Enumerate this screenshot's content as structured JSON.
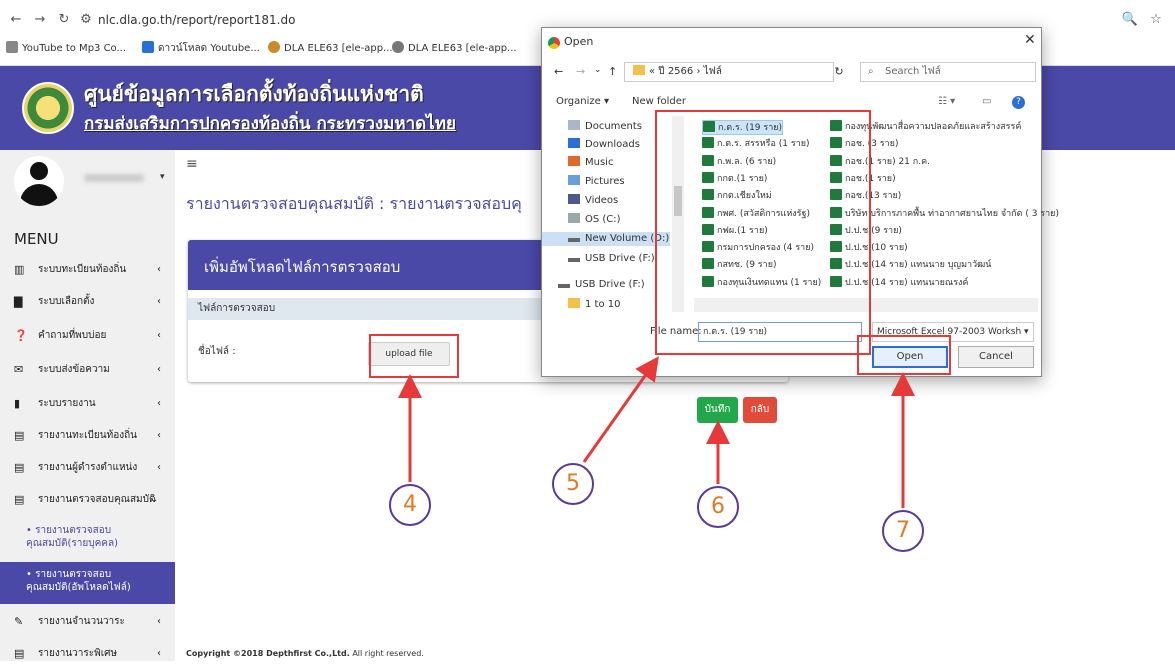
{
  "browser": {
    "url": "nlc.dla.go.th/report/report181.do",
    "bookmarks": [
      "YouTube to Mp3 Co...",
      "ดาวน์โหลด Youtube...",
      "DLA ELE63 [ele-app...",
      "DLA ELE63 [ele-app..."
    ]
  },
  "site": {
    "title": "ศูนย์ข้อมูลการเลือกตั้งท้องถิ่นแห่งชาติ",
    "subtitle": "กรมส่งเสริมการปกครองท้องถิ่น กระทรวงมหาดไทย"
  },
  "sidebar": {
    "menu_title": "MENU",
    "items": [
      {
        "icon": "▥",
        "label": "ระบบทะเบียนท้องถิ่น",
        "chevron": "‹"
      },
      {
        "icon": "▇",
        "label": "ระบบเลือกตั้ง",
        "chevron": "‹"
      },
      {
        "icon": "❓",
        "label": "คำถามที่พบบ่อย",
        "chevron": "‹"
      },
      {
        "icon": "✉",
        "label": "ระบบส่งข้อความ",
        "chevron": "‹"
      },
      {
        "icon": "▮",
        "label": "ระบบรายงาน",
        "chevron": "‹"
      },
      {
        "icon": "▤",
        "label": "รายงานทะเบียนท้องถิ่น",
        "chevron": "‹"
      },
      {
        "icon": "▤",
        "label": "รายงานผู้ดำรงตำแหน่ง",
        "chevron": "‹"
      },
      {
        "icon": "▤",
        "label": "รายงานตรวจสอบคุณสมบัติ",
        "chevron": "⌄"
      }
    ],
    "sub_items": [
      "• รายงานตรวจสอบ คุณสมบัติ(รายบุคคล)",
      "• รายงานตรวจสอบ คุณสมบัติ(อัพโหลดไฟล์)"
    ],
    "bottom_items": [
      {
        "icon": "✎",
        "label": "รายงานจำนวนวาระ",
        "chevron": "‹"
      },
      {
        "icon": "▤",
        "label": "รายงานวาระพิเศษ",
        "chevron": "‹"
      }
    ]
  },
  "main": {
    "page_title": "รายงานตรวจสอบคุณสมบัติ : รายงานตรวจสอบคุ",
    "card_title": "เพิ่มอัพโหลดไฟล์การตรวจสอบ",
    "card_sub": "ไฟล์การตรวจสอบ",
    "file_label": "ชื่อไฟล์ :",
    "upload_label": "upload file",
    "save_label": "บันทึก",
    "back_label": "กลับ",
    "copyright_bold": "Copyright ©2018 Depthfirst Co.,Ltd.",
    "copyright_rest": " All right reserved."
  },
  "annotations": [
    "4",
    "5",
    "6",
    "7"
  ],
  "dialog": {
    "title": "Open",
    "path": "« ปี 2566 › ไฟล์",
    "search_placeholder": "Search ไฟล์",
    "organize": "Organize ▾",
    "new_folder": "New folder",
    "nav": [
      "Documents",
      "Downloads",
      "Music",
      "Pictures",
      "Videos",
      "OS (C:)",
      "New Volume (D:)",
      "USB Drive (F:)",
      "USB Drive (F:)",
      "1 to 10"
    ],
    "files_col1": [
      "ก.ต.ร. (19 ราย)",
      "ก.ต.ร. สรรหรือ (1 ราย)",
      "ก.พ.ล. (6 ราย)",
      "กกต.(1 ราย)",
      "กกต.เชียงใหม่",
      "กพศ. (สวัสดิการแห่งรัฐ)",
      "กฟผ.(1 ราย)",
      "กรมการปกครอง (4 ราย)",
      "กสทช. (9 ราย)",
      "กองทุนเงินทดแทน (1 ราย)"
    ],
    "files_col2": [
      "กองทุนพัฒนาสื่อความปลอดภัยและสร้างสรรค์",
      "กอช. (3 ราย)",
      "กอช.(1 ราย) 21 ก.ค.",
      "กอช.(1 ราย)",
      "กอช.(13 ราย)",
      "บริษัท บริการภาคพื้น ท่าอากาศยานไทย จำกัด ( 3 ราย)",
      "ป.ป.ช.(9 ราย)",
      "ป.ป.ช.(10 ราย)",
      "ป.ป.ช.(14 ราย) แทนนาย บุญมาวัฒน์",
      "ป.ป.ช.(14 ราย) แทนนายณรงค์"
    ],
    "filename_label": "File name:",
    "filename_value": "ก.ต.ร. (19 ราย)",
    "filetype": "Microsoft Excel 97-2003 Worksh ▾",
    "open_label": "Open",
    "cancel_label": "Cancel"
  }
}
